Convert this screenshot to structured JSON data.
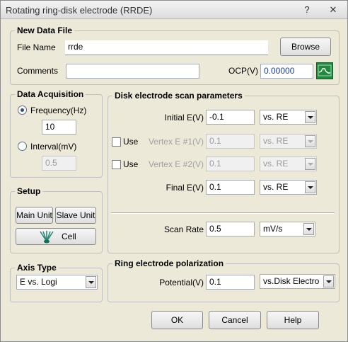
{
  "window": {
    "title": "Rotating ring-disk electrode (RRDE)",
    "help_glyph": "?",
    "close_glyph": "✕"
  },
  "new_data_file": {
    "group_label": "New Data File",
    "file_name_label": "File Name",
    "file_name_value": "rrde",
    "browse_label": "Browse",
    "comments_label": "Comments",
    "comments_value": "",
    "ocp_label": "OCP(V)",
    "ocp_value": "0.00000",
    "ocp_icon": "waveform-icon"
  },
  "data_acquisition": {
    "group_label": "Data Acquisition",
    "frequency_label": "Frequency(Hz)",
    "frequency_value": "10",
    "interval_label": "Interval(mV)",
    "interval_value": "0.5",
    "selected": "frequency"
  },
  "setup": {
    "group_label": "Setup",
    "main_unit_label": "Main Unit",
    "slave_unit_label": "Slave Unit",
    "cell_label": "Cell",
    "cell_icon": "electrode-cell-icon"
  },
  "axis_type": {
    "group_label": "Axis Type",
    "selected": "E vs. Logi"
  },
  "disk_scan": {
    "group_label": "Disk electrode scan parameters",
    "initial_label": "Initial E(V)",
    "initial_value": "-0.1",
    "initial_ref": "vs. RE",
    "use_label": "Use",
    "vertex1_label": "Vertex E #1(V)",
    "vertex1_value": "0.1",
    "vertex1_ref": "vs. RE",
    "vertex2_label": "Vertex E #2(V)",
    "vertex2_value": "0.1",
    "vertex2_ref": "vs. RE",
    "final_label": "Final E(V)",
    "final_value": "0.1",
    "final_ref": "vs. RE",
    "scan_rate_label": "Scan Rate",
    "scan_rate_value": "0.5",
    "scan_rate_unit": "mV/s"
  },
  "ring_polarization": {
    "group_label": "Ring electrode polarization",
    "potential_label": "Potential(V)",
    "potential_value": "0.1",
    "potential_ref": "vs.Disk Electro"
  },
  "footer": {
    "ok_label": "OK",
    "cancel_label": "Cancel",
    "help_label": "Help"
  },
  "colors": {
    "ocp_icon_bg": "#1f8a3e",
    "ocp_value_text": "#1a3d8f",
    "radio_dot": "#1f4f9a"
  }
}
